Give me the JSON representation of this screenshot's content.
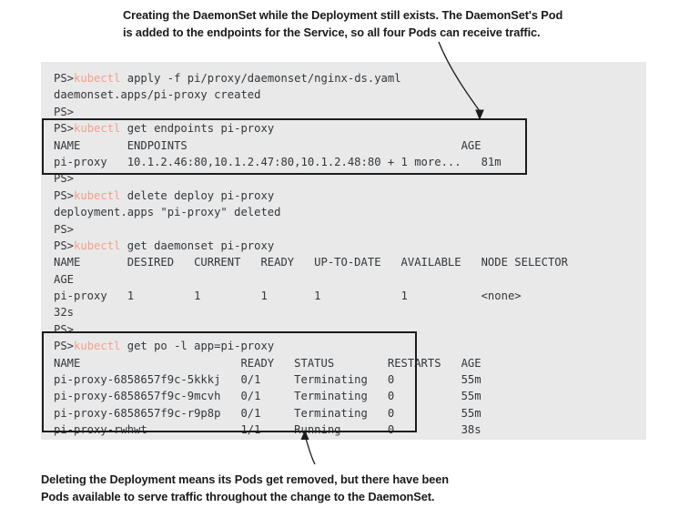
{
  "captions": {
    "top": {
      "line1": "Creating the DaemonSet while the Deployment still exists. The DaemonSet's Pod",
      "line2": "is added to the endpoints for the Service, so all four Pods can receive traffic."
    },
    "bottom": {
      "line1": "Deleting the Deployment means its Pods get removed, but there have been",
      "line2": "Pods available to serve traffic throughout the change to the DaemonSet."
    }
  },
  "colors": {
    "terminal_bg": "#e9e9e9",
    "terminal_fg": "#33373b",
    "command_accent": "#f4a08b",
    "box_border": "#1c1c1c",
    "caption_fg": "#1a1a1a"
  },
  "terminal": {
    "prompt": "PS>",
    "command_word": "kubectl",
    "lines": [
      {
        "id": "l01",
        "prompt": "PS>",
        "cmd": "kubectl",
        "rest": " apply -f pi/proxy/daemonset/nginx-ds.yaml"
      },
      {
        "id": "l02",
        "text": "daemonset.apps/pi-proxy created"
      },
      {
        "id": "l03",
        "text": "PS>"
      },
      {
        "id": "l04",
        "prompt": "PS>",
        "cmd": "kubectl",
        "rest": " get endpoints pi-proxy"
      },
      {
        "id": "l05",
        "text": "NAME       ENDPOINTS                                         AGE"
      },
      {
        "id": "l06",
        "text": "pi-proxy   10.1.2.46:80,10.1.2.47:80,10.1.2.48:80 + 1 more...   81m"
      },
      {
        "id": "l07",
        "text": "PS>"
      },
      {
        "id": "l08",
        "prompt": "PS>",
        "cmd": "kubectl",
        "rest": " delete deploy pi-proxy"
      },
      {
        "id": "l09",
        "text": "deployment.apps \"pi-proxy\" deleted"
      },
      {
        "id": "l10",
        "text": "PS>"
      },
      {
        "id": "l11",
        "prompt": "PS>",
        "cmd": "kubectl",
        "rest": " get daemonset pi-proxy"
      },
      {
        "id": "l12",
        "text": "NAME       DESIRED   CURRENT   READY   UP-TO-DATE   AVAILABLE   NODE SELECTOR"
      },
      {
        "id": "l13",
        "text": "AGE"
      },
      {
        "id": "l14",
        "text": "pi-proxy   1         1         1       1            1           <none>"
      },
      {
        "id": "l15",
        "text": "32s"
      },
      {
        "id": "l16",
        "text": "PS>"
      },
      {
        "id": "l17",
        "prompt": "PS>",
        "cmd": "kubectl",
        "rest": " get po -l app=pi-proxy"
      },
      {
        "id": "l18",
        "text": "NAME                        READY   STATUS        RESTARTS   AGE"
      },
      {
        "id": "l19",
        "text": "pi-proxy-6858657f9c-5kkkj   0/1     Terminating   0          55m"
      },
      {
        "id": "l20",
        "text": "pi-proxy-6858657f9c-9mcvh   0/1     Terminating   0          55m"
      },
      {
        "id": "l21",
        "text": "pi-proxy-6858657f9c-r9p8p   0/1     Terminating   0          55m"
      },
      {
        "id": "l22",
        "text": "pi-proxy-rwhwt              1/1     Running       0          38s"
      }
    ],
    "tables": {
      "endpoints": {
        "headers": [
          "NAME",
          "ENDPOINTS",
          "AGE"
        ],
        "rows": [
          [
            "pi-proxy",
            "10.1.2.46:80,10.1.2.47:80,10.1.2.48:80 + 1 more...",
            "81m"
          ]
        ]
      },
      "daemonset": {
        "headers": [
          "NAME",
          "DESIRED",
          "CURRENT",
          "READY",
          "UP-TO-DATE",
          "AVAILABLE",
          "NODE SELECTOR",
          "AGE"
        ],
        "rows": [
          [
            "pi-proxy",
            "1",
            "1",
            "1",
            "1",
            "1",
            "<none>",
            "32s"
          ]
        ]
      },
      "pods": {
        "headers": [
          "NAME",
          "READY",
          "STATUS",
          "RESTARTS",
          "AGE"
        ],
        "rows": [
          [
            "pi-proxy-6858657f9c-5kkkj",
            "0/1",
            "Terminating",
            "0",
            "55m"
          ],
          [
            "pi-proxy-6858657f9c-9mcvh",
            "0/1",
            "Terminating",
            "0",
            "55m"
          ],
          [
            "pi-proxy-6858657f9c-r9p8p",
            "0/1",
            "Terminating",
            "0",
            "55m"
          ],
          [
            "pi-proxy-rwhwt",
            "1/1",
            "Running",
            "0",
            "38s"
          ]
        ]
      }
    }
  },
  "annotations": {
    "highlight_endpoints_label": "endpoints-output-highlight",
    "highlight_pods_label": "pods-output-highlight",
    "arrow_top_label": "arrow-to-endpoints",
    "arrow_bottom_label": "arrow-to-pods"
  }
}
